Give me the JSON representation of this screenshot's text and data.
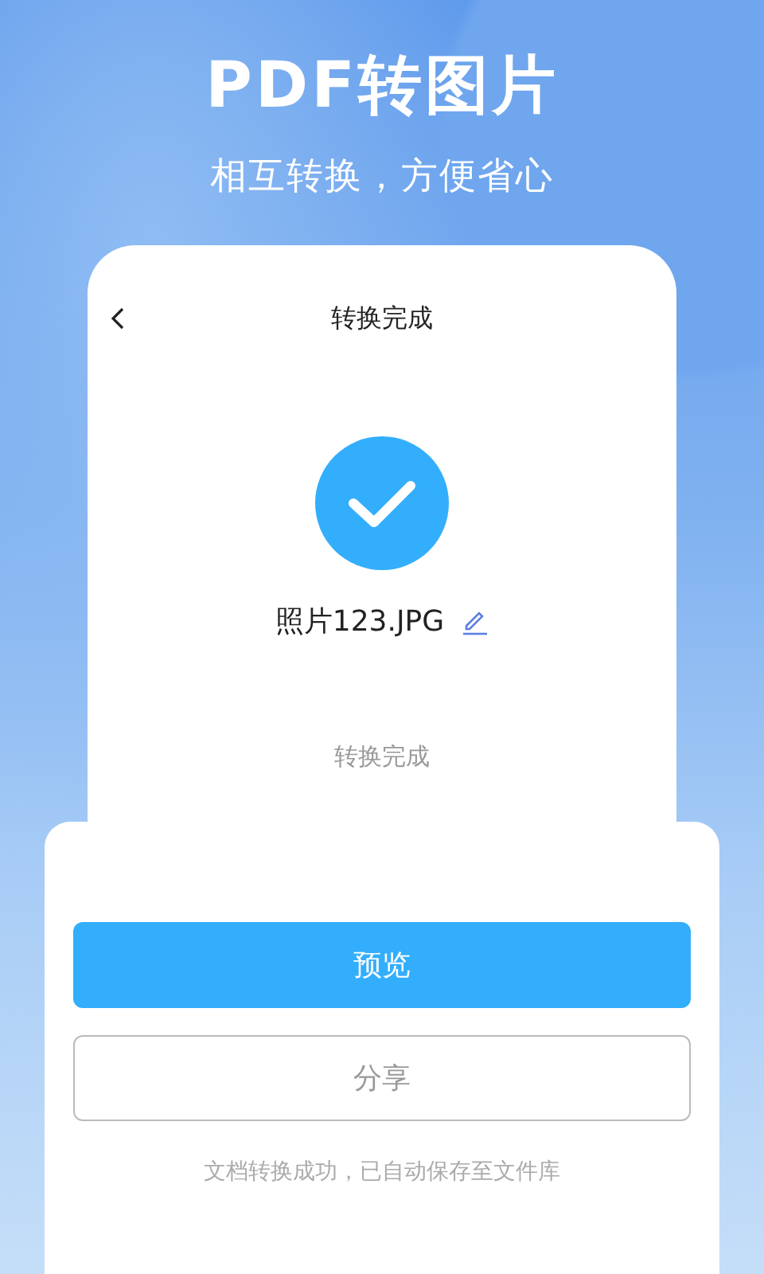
{
  "headline": {
    "title": "PDF转图片",
    "subtitle": "相互转换，方便省心"
  },
  "screen": {
    "title": "转换完成",
    "file_name": "照片123.JPG",
    "status": "转换完成"
  },
  "sheet": {
    "buttons": [
      {
        "label": "预览",
        "kind": "primary"
      },
      {
        "label": "分享",
        "kind": "outline"
      }
    ],
    "note": "文档转换成功，已自动保存至文件库"
  }
}
